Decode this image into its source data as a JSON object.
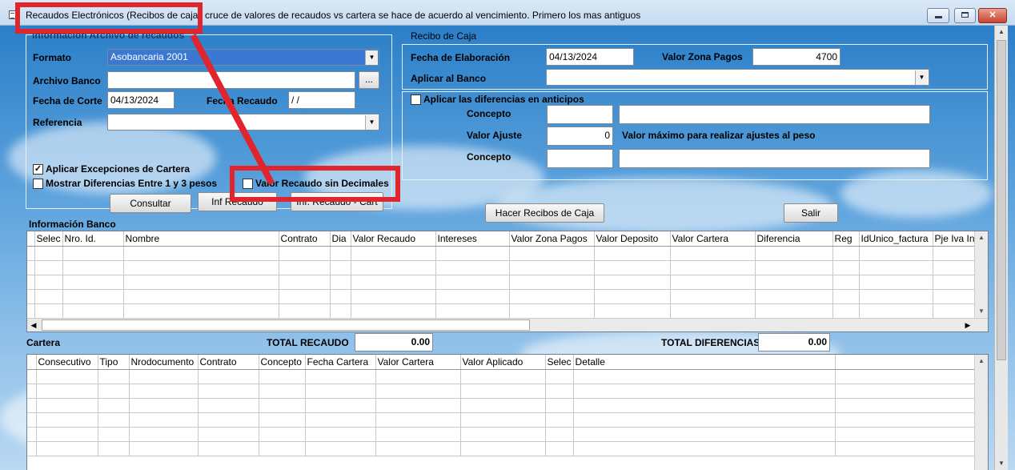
{
  "window": {
    "title": "Recaudos Electrónicos (Recibos de caja)",
    "title_rest": "l  cruce de valores de recaudos vs cartera se hace de acuerdo al vencimiento. Primero los mas antiguos",
    "minimize": "",
    "maximize": "",
    "close": "✕"
  },
  "left_panel": {
    "group_title": "Información Archivo de recaudos",
    "formato_label": "Formato",
    "formato_value": "Asobancaria 2001",
    "archivo_label": "Archivo Banco",
    "archivo_value": "",
    "browse_label": "...",
    "fecha_corte_label": "Fecha de Corte",
    "fecha_corte_value": "04/13/2024",
    "fecha_recaudo_label": "Fecha Recaudo",
    "fecha_recaudo_value": " /  /",
    "referencia_label": "Referencia",
    "referencia_value": "",
    "chk_excepciones_label": "Aplicar Excepciones de Cartera",
    "chk_excepciones_mark": "✓",
    "chk_diferencias_label": "Mostrar Diferencias Entre 1 y 3 pesos",
    "chk_sin_decimales_label": "Valor Recaudo sin Decimales",
    "btn_consultar": "Consultar",
    "btn_inf_recaudo": "Inf Recaudo",
    "btn_inf_recaudo_cart": "Inf. Recaudo - Cart"
  },
  "recibo": {
    "group_title": "Recibo de Caja",
    "fecha_elab_label": "Fecha de Elaboración",
    "fecha_elab_value": "04/13/2024",
    "valor_zona_label": "Valor Zona Pagos",
    "valor_zona_value": "4700",
    "aplicar_banco_label": "Aplicar al Banco",
    "aplicar_banco_value": "",
    "chk_anticipos_label": "Aplicar las diferencias en anticipos",
    "concepto_label": "Concepto",
    "concepto_code": "",
    "concepto_desc": "",
    "valor_ajuste_label": "Valor Ajuste",
    "valor_ajuste_value": "0",
    "valor_ajuste_note": "Valor máximo para realizar ajustes al peso",
    "concepto2_label": "Concepto",
    "concepto2_code": "",
    "concepto2_desc": ""
  },
  "actions": {
    "hacer_recibos": "Hacer Recibos de Caja",
    "salir": "Salir"
  },
  "banco_grid": {
    "title": "Información Banco",
    "columns": [
      "",
      "Selec",
      "Nro. Id.",
      "Nombre",
      "Contrato",
      "Dia",
      "Valor Recaudo",
      "Intereses",
      "Valor Zona Pagos",
      "Valor Deposito",
      "Valor Cartera",
      "Diferencia",
      "Reg",
      "IdUnico_factura",
      "Pje Iva Int"
    ],
    "row_count": 5
  },
  "cartera": {
    "title": "Cartera",
    "total_recaudo_label": "TOTAL RECAUDO",
    "total_recaudo_value": "0.00",
    "total_diferencias_label": "TOTAL DIFERENCIAS",
    "total_diferencias_value": "0.00",
    "columns": [
      "",
      "Consecutivo",
      "Tipo",
      "Nrodocumento",
      "Contrato",
      "Concepto",
      "Fecha Cartera",
      "Valor Cartera",
      "Valor Aplicado",
      "Selec",
      "Detalle",
      ""
    ],
    "row_count": 6
  },
  "colors": {
    "highlight": "#e0252c",
    "selection": "#3a78d1"
  }
}
